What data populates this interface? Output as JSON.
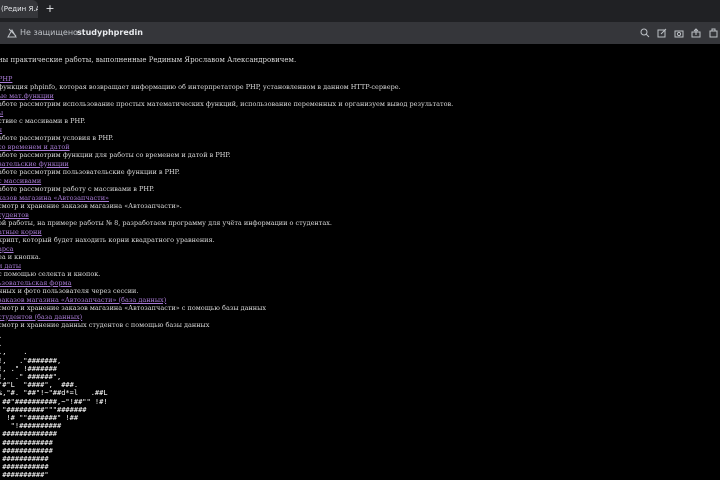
{
  "browser": {
    "tab_title": "(Редин Я.А.",
    "new_tab": "+",
    "security_label": "Не защищено",
    "url": "studyphpredin",
    "toolbar_icons": [
      "search-icon",
      "edit-icon",
      "camera-icon",
      "share-icon",
      "extension-icon"
    ]
  },
  "page": {
    "intro": "ны практические работы, выполненные Рединым Ярославом Александровичем.",
    "items": [
      {
        "link": " PHP",
        "desc": " функция phpinfo, которая возвращает информацию об интерпретаторе PHP, установленном в данном HTTP-сервере."
      },
      {
        "link": "ые мат.функции",
        "desc": "аботе рассмотрим использование простых математических функций, использование переменных и организуем вывод результатов."
      },
      {
        "link": "ы",
        "desc": "ствие с массивами в PHP."
      },
      {
        "link": "я",
        "desc": "аботе рассмотрим условия в PHP."
      },
      {
        "link": " со временем и датой",
        "desc": "аботе рассмотрим функции для работы со временем и датой в PHP."
      },
      {
        "link": "вательские функции",
        "desc": "аботе рассмотрим пользовательские функции в PHP."
      },
      {
        "link": "с массивами",
        "desc": "аботе рассмотрим работу с массивами в PHP."
      },
      {
        "link": "казов магазина «Автозапчасти»",
        "desc": "смотр и хранение заказов магазина «Автозапчасти»."
      },
      {
        "link": "тудентов",
        "desc": "ой работы, на примере работы № 8, разработаем программу для учёта информации о студентах."
      },
      {
        "link": "атные корни",
        "desc": "крипт, который будет находить корни квадратного уравнения."
      },
      {
        "link": "арса",
        "desc": "ea и кнопка."
      },
      {
        "link": "и даты",
        "desc": " с помощью селекта и кнопок."
      },
      {
        "link": "ьзовательская форма",
        "desc": "нных и фото пользователя через сессии."
      },
      {
        "link": "заказов магазина «Автозапчасти» (база данных)",
        "desc": "смотр и хранение заказов магазина «Автозапчасти» с помощью базы данных"
      },
      {
        "link": "студентов (база данных)",
        "desc": "смотр и хранение данных студентов с помощью базы данных"
      }
    ],
    "ascii_art": ".\n.\n.,    .\n!,   .\"#######,\n!, .\" !#######\n!,  .\" ######\",\n\"#\"L  \"####\",  ###.\n%,\"#. \"##\"!~\"##d*=l   .##L\n ##\"##########,~\"!##\"\" !#!\n \"#########\"\"\"#######\n  !# \"\"#######\" !##\n   \"!##########\n #############\n ############\n ############\n ###########\n ###########\n ##########\"\n #########\"\n ########\""
  }
}
